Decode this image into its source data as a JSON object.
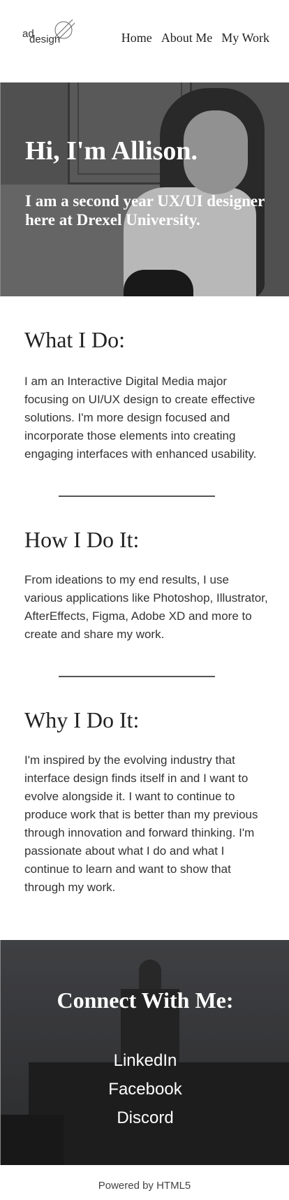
{
  "header": {
    "logo_top": "ad",
    "logo_bottom": "design",
    "nav": [
      {
        "label": "Home"
      },
      {
        "label": "About Me"
      },
      {
        "label": "My Work"
      }
    ]
  },
  "hero": {
    "title": "Hi, I'm Allison.",
    "subtitle": "I am a second year UX/UI designer here at Drexel University."
  },
  "sections": [
    {
      "heading": "What I Do:",
      "body": "I am an Interactive Digital Media major focusing on UI/UX design to create effective solutions. I'm more design focused and incorporate those elements into creating engaging interfaces with enhanced usability."
    },
    {
      "heading": "How I Do It:",
      "body": "From ideations to my end results, I use various applications like Photoshop, Illustrator, AfterEffects, Figma, Adobe XD and more to create and share my work."
    },
    {
      "heading": "Why I Do It:",
      "body": "I'm inspired by the evolving industry that interface design finds itself in and I want to evolve alongside it. I want to continue to produce work that is better than my previous through innovation and forward thinking. I'm passionate about what I do and what I continue to learn and want to show that through my work."
    }
  ],
  "connect": {
    "heading": "Connect With Me:",
    "links": [
      {
        "label": "LinkedIn"
      },
      {
        "label": "Facebook"
      },
      {
        "label": "Discord"
      }
    ]
  },
  "footer": {
    "text": "Powered by HTML5"
  }
}
